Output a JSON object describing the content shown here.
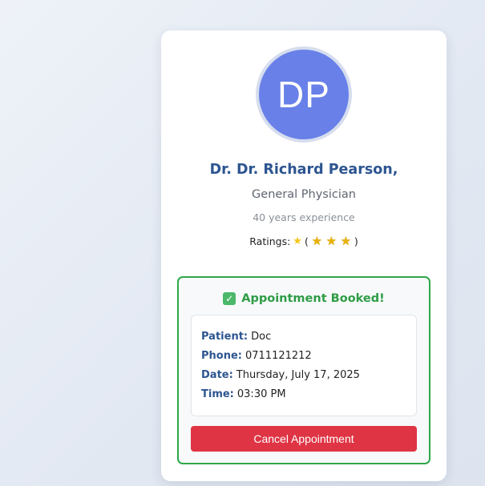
{
  "doctor": {
    "initials": "DP",
    "name": "Dr. Dr. Richard Pearson,",
    "specialty": "General Physician",
    "experience": "40 years experience",
    "ratings_label": "Ratings:",
    "rating_star": "★",
    "rating_badges": [
      "★",
      "★",
      "★"
    ],
    "avatar_color": "#6880e8"
  },
  "booking": {
    "title": "Appointment Booked!",
    "check_icon": "✓",
    "accent_color": "#2fa84a",
    "details": [
      {
        "label": "Patient:",
        "value": "Doc"
      },
      {
        "label": "Phone:",
        "value": "0711121212"
      },
      {
        "label": "Date:",
        "value": "Thursday, July 17, 2025"
      },
      {
        "label": "Time:",
        "value": "03:30 PM"
      }
    ],
    "cancel_label": "Cancel Appointment",
    "cancel_color": "#df3444"
  }
}
